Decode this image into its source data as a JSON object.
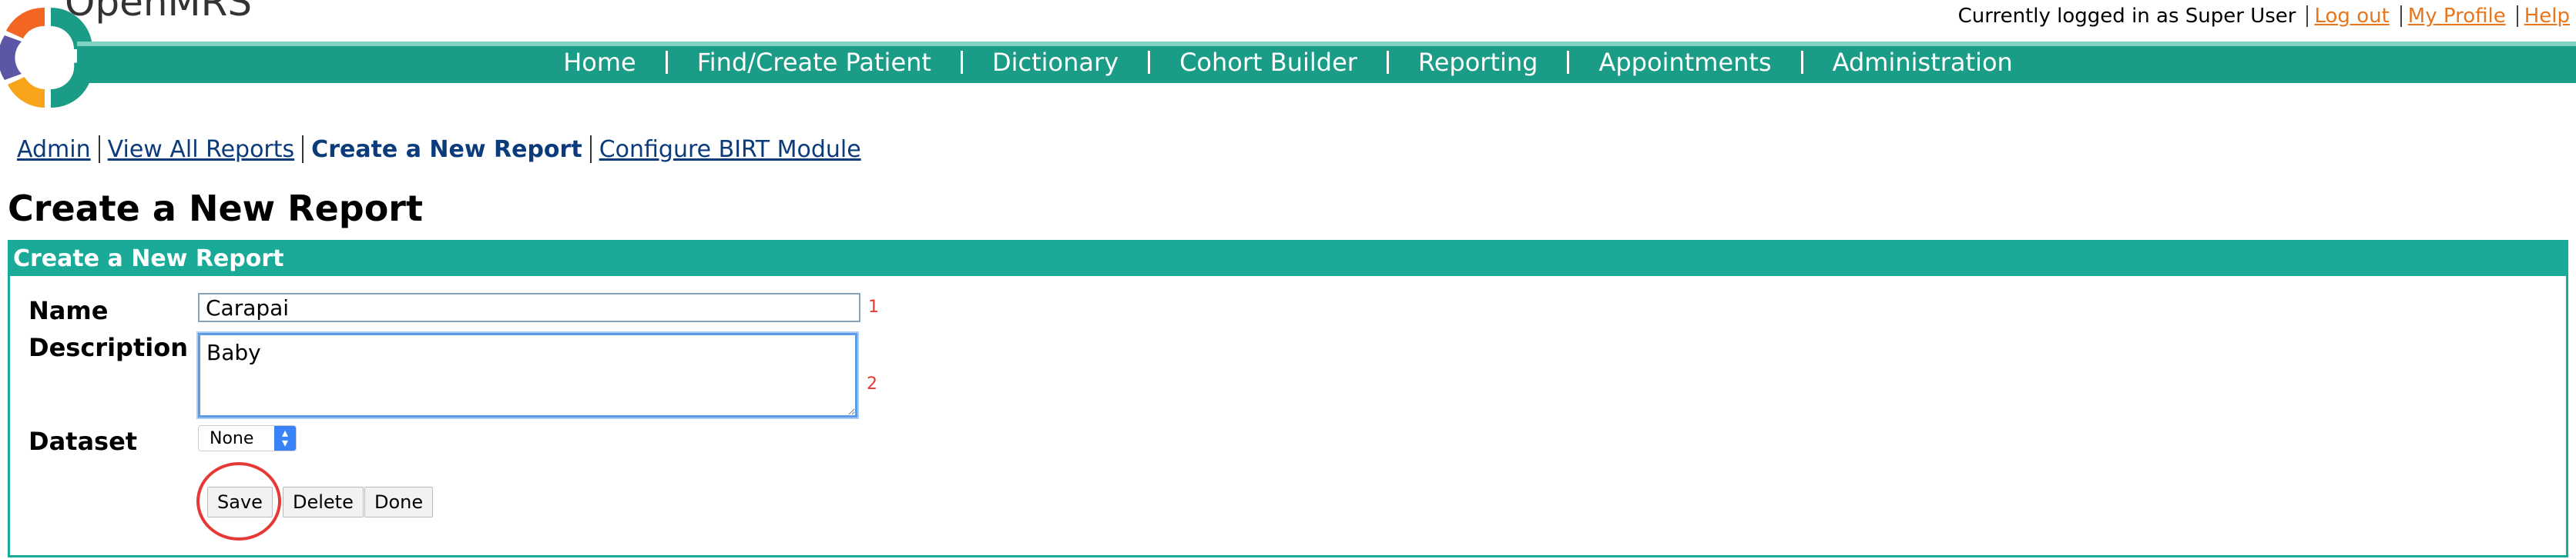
{
  "brand": "OpenMRS",
  "user_bar": {
    "logged_in_text": "Currently logged in as Super User",
    "logout": "Log out",
    "profile": "My Profile",
    "help": "Help"
  },
  "nav": {
    "items": [
      "Home",
      "Find/Create Patient",
      "Dictionary",
      "Cohort Builder",
      "Reporting",
      "Appointments",
      "Administration"
    ]
  },
  "subnav": {
    "admin": "Admin",
    "view_all": "View All Reports",
    "create": "Create a New Report",
    "configure": "Configure BIRT Module"
  },
  "page_title": "Create a New Report",
  "form": {
    "header": "Create a New Report",
    "name_label": "Name",
    "name_value": "Carapai",
    "name_marker": "1",
    "description_label": "Description",
    "description_value": "Baby",
    "description_marker": "2",
    "dataset_label": "Dataset",
    "dataset_value": "None",
    "save": "Save",
    "delete": "Delete",
    "done": "Done"
  },
  "colors": {
    "nav_bg": "#1a9c87",
    "box_accent": "#1aab98",
    "link_orange": "#e8761d",
    "annotation_red": "#e53935"
  }
}
